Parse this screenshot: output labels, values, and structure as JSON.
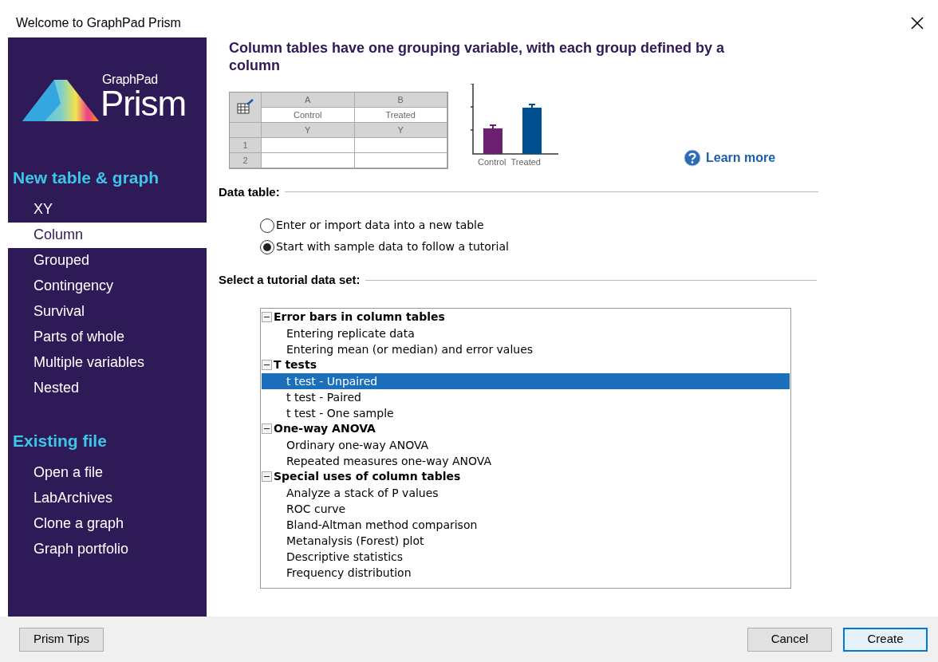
{
  "window": {
    "title": "Welcome to GraphPad Prism"
  },
  "sidebar": {
    "logo": {
      "small": "GraphPad",
      "large": "Prism"
    },
    "sections": [
      {
        "heading": "New table & graph",
        "items": [
          {
            "label": "XY",
            "selected": false
          },
          {
            "label": "Column",
            "selected": true
          },
          {
            "label": "Grouped",
            "selected": false
          },
          {
            "label": "Contingency",
            "selected": false
          },
          {
            "label": "Survival",
            "selected": false
          },
          {
            "label": "Parts of whole",
            "selected": false
          },
          {
            "label": "Multiple variables",
            "selected": false
          },
          {
            "label": "Nested",
            "selected": false
          }
        ]
      },
      {
        "heading": "Existing file",
        "items": [
          {
            "label": "Open a file",
            "selected": false
          },
          {
            "label": "LabArchives",
            "selected": false
          },
          {
            "label": "Clone a graph",
            "selected": false
          },
          {
            "label": "Graph portfolio",
            "selected": false
          }
        ]
      }
    ]
  },
  "main": {
    "heading": "Column tables have one grouping variable, with each group defined by a column",
    "sample_table": {
      "columns": [
        {
          "letter": "A",
          "title": "Control",
          "type": "Y"
        },
        {
          "letter": "B",
          "title": "Treated",
          "type": "Y"
        }
      ],
      "rows": [
        "1",
        "2"
      ]
    },
    "sample_graph": {
      "labels": [
        "Control",
        "Treated"
      ]
    },
    "learn_more": "Learn more",
    "data_table": {
      "label": "Data table:",
      "options": [
        {
          "label": "Enter or import data into a new table",
          "selected": false
        },
        {
          "label": "Start with sample data to follow a tutorial",
          "selected": true
        }
      ]
    },
    "tutorial": {
      "label": "Select a tutorial data set:",
      "groups": [
        {
          "label": "Error bars in column tables",
          "expanded": true,
          "children": [
            {
              "label": "Entering replicate data",
              "selected": false
            },
            {
              "label": "Entering mean (or median) and error values",
              "selected": false
            }
          ]
        },
        {
          "label": "T tests",
          "expanded": true,
          "children": [
            {
              "label": "t test - Unpaired",
              "selected": true
            },
            {
              "label": "t test - Paired",
              "selected": false
            },
            {
              "label": "t test - One sample",
              "selected": false
            }
          ]
        },
        {
          "label": "One-way ANOVA",
          "expanded": true,
          "children": [
            {
              "label": "Ordinary one-way ANOVA",
              "selected": false
            },
            {
              "label": "Repeated measures one-way ANOVA",
              "selected": false
            }
          ]
        },
        {
          "label": "Special uses of column tables",
          "expanded": true,
          "children": [
            {
              "label": "Analyze a stack of P values",
              "selected": false
            },
            {
              "label": "ROC curve",
              "selected": false
            },
            {
              "label": "Bland-Altman method comparison",
              "selected": false
            },
            {
              "label": "Metanalysis (Forest) plot",
              "selected": false
            },
            {
              "label": "Descriptive statistics",
              "selected": false
            },
            {
              "label": "Frequency distribution",
              "selected": false
            }
          ]
        }
      ]
    }
  },
  "footer": {
    "tips": "Prism Tips",
    "cancel": "Cancel",
    "create": "Create"
  }
}
